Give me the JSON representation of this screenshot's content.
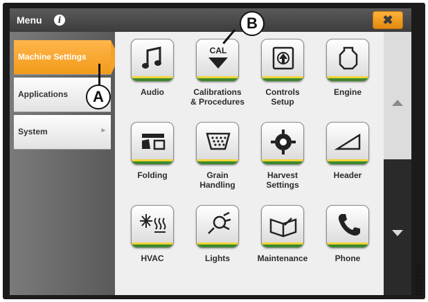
{
  "header": {
    "title": "Menu",
    "info_icon": "info-icon",
    "close_label": "✖"
  },
  "sidebar": {
    "items": [
      {
        "label": "Machine Settings",
        "active": true
      },
      {
        "label": "Applications",
        "active": false
      },
      {
        "label": "System",
        "active": false,
        "arrow": "▶"
      }
    ]
  },
  "tiles": [
    {
      "label": "Audio",
      "icon": "music-note-icon"
    },
    {
      "label": "Calibrations\n& Procedures",
      "icon": "cal-icon",
      "icon_text": "CAL"
    },
    {
      "label": "Controls\nSetup",
      "icon": "controls-icon"
    },
    {
      "label": "Engine",
      "icon": "engine-icon"
    },
    {
      "label": "Folding",
      "icon": "folding-icon"
    },
    {
      "label": "Grain\nHandling",
      "icon": "grain-icon"
    },
    {
      "label": "Harvest\nSettings",
      "icon": "harvest-gear-icon"
    },
    {
      "label": "Header",
      "icon": "header-wedge-icon"
    },
    {
      "label": "HVAC",
      "icon": "hvac-icon"
    },
    {
      "label": "Lights",
      "icon": "light-icon"
    },
    {
      "label": "Maintenance",
      "icon": "book-icon"
    },
    {
      "label": "Phone",
      "icon": "phone-icon"
    }
  ],
  "callouts": {
    "a": "A",
    "b": "B"
  },
  "figure_number": "1022786",
  "colors": {
    "active_tab": "#f5a12a",
    "close_button": "#f0a020",
    "tile_stripe_yellow": "#f2d43a",
    "tile_stripe_green": "#3a8a2a"
  }
}
